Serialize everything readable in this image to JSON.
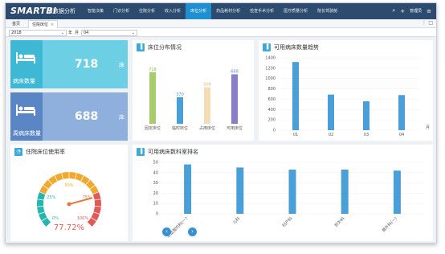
{
  "app": {
    "logo": "SMARTBI",
    "subtitle": "大数据分析",
    "user": "管理员"
  },
  "nav": [
    "智能决策",
    "门诊分析",
    "住院分析",
    "收入分析",
    "床位分析",
    "药品耗材分析",
    "检查手术分析",
    "医疗质量分析",
    "院长驾驶舱"
  ],
  "nav_active_index": 4,
  "tabs": [
    {
      "label": "首页"
    },
    {
      "label": "住院床位",
      "close": "×"
    }
  ],
  "filters": {
    "year_value": "2018",
    "year_suffix": "年",
    "month_value": "04",
    "month_suffix": "月"
  },
  "kpis": [
    {
      "label": "病床数量",
      "value": "718",
      "unit": "床"
    },
    {
      "label": "周病床数量",
      "value": "688",
      "unit": "床"
    }
  ],
  "panels": {
    "bed_distribution": "床位分布情况",
    "available_trend": "可用病床数量趋势",
    "usage_rate": "住院床位使用率",
    "available_ranking": "可用病床数科室排名"
  },
  "gauge": {
    "value": 77.72,
    "display": "77.72%",
    "ticks": [
      "0%",
      "25%",
      "50%",
      "75%",
      "100%"
    ]
  },
  "chart_data": [
    {
      "type": "bar",
      "title": "床位分布情况",
      "categories": [
        "固定床位",
        "临时床位",
        "占用床位",
        "可用床位"
      ],
      "values": [
        718,
        370,
        508,
        688
      ],
      "colors": [
        "#a9cc6a",
        "#4a9fd8",
        "#f3dcb6",
        "#8a7ec7"
      ]
    },
    {
      "type": "bar",
      "title": "可用病床数量趋势",
      "categories": [
        "01",
        "02",
        "03",
        "04"
      ],
      "values": [
        1320,
        690,
        560,
        680
      ],
      "ylim": [
        0,
        1400
      ],
      "yticks": [
        "0",
        "200",
        "400",
        "600",
        "800",
        "1000",
        "1200",
        "1400"
      ],
      "xlabel": "月",
      "color": "#4a9fd8"
    },
    {
      "type": "bar",
      "title": "可用病床数科室排名",
      "categories": [
        "心血管内科(一)",
        "儿科",
        "妇产科",
        "肝外科",
        "普外科(一)"
      ],
      "values": [
        48,
        45,
        43,
        43,
        42
      ],
      "ylim": [
        0,
        50
      ],
      "yticks": [
        "0",
        "10",
        "20",
        "30",
        "40",
        "50"
      ],
      "color": "#4a9fd8"
    }
  ]
}
